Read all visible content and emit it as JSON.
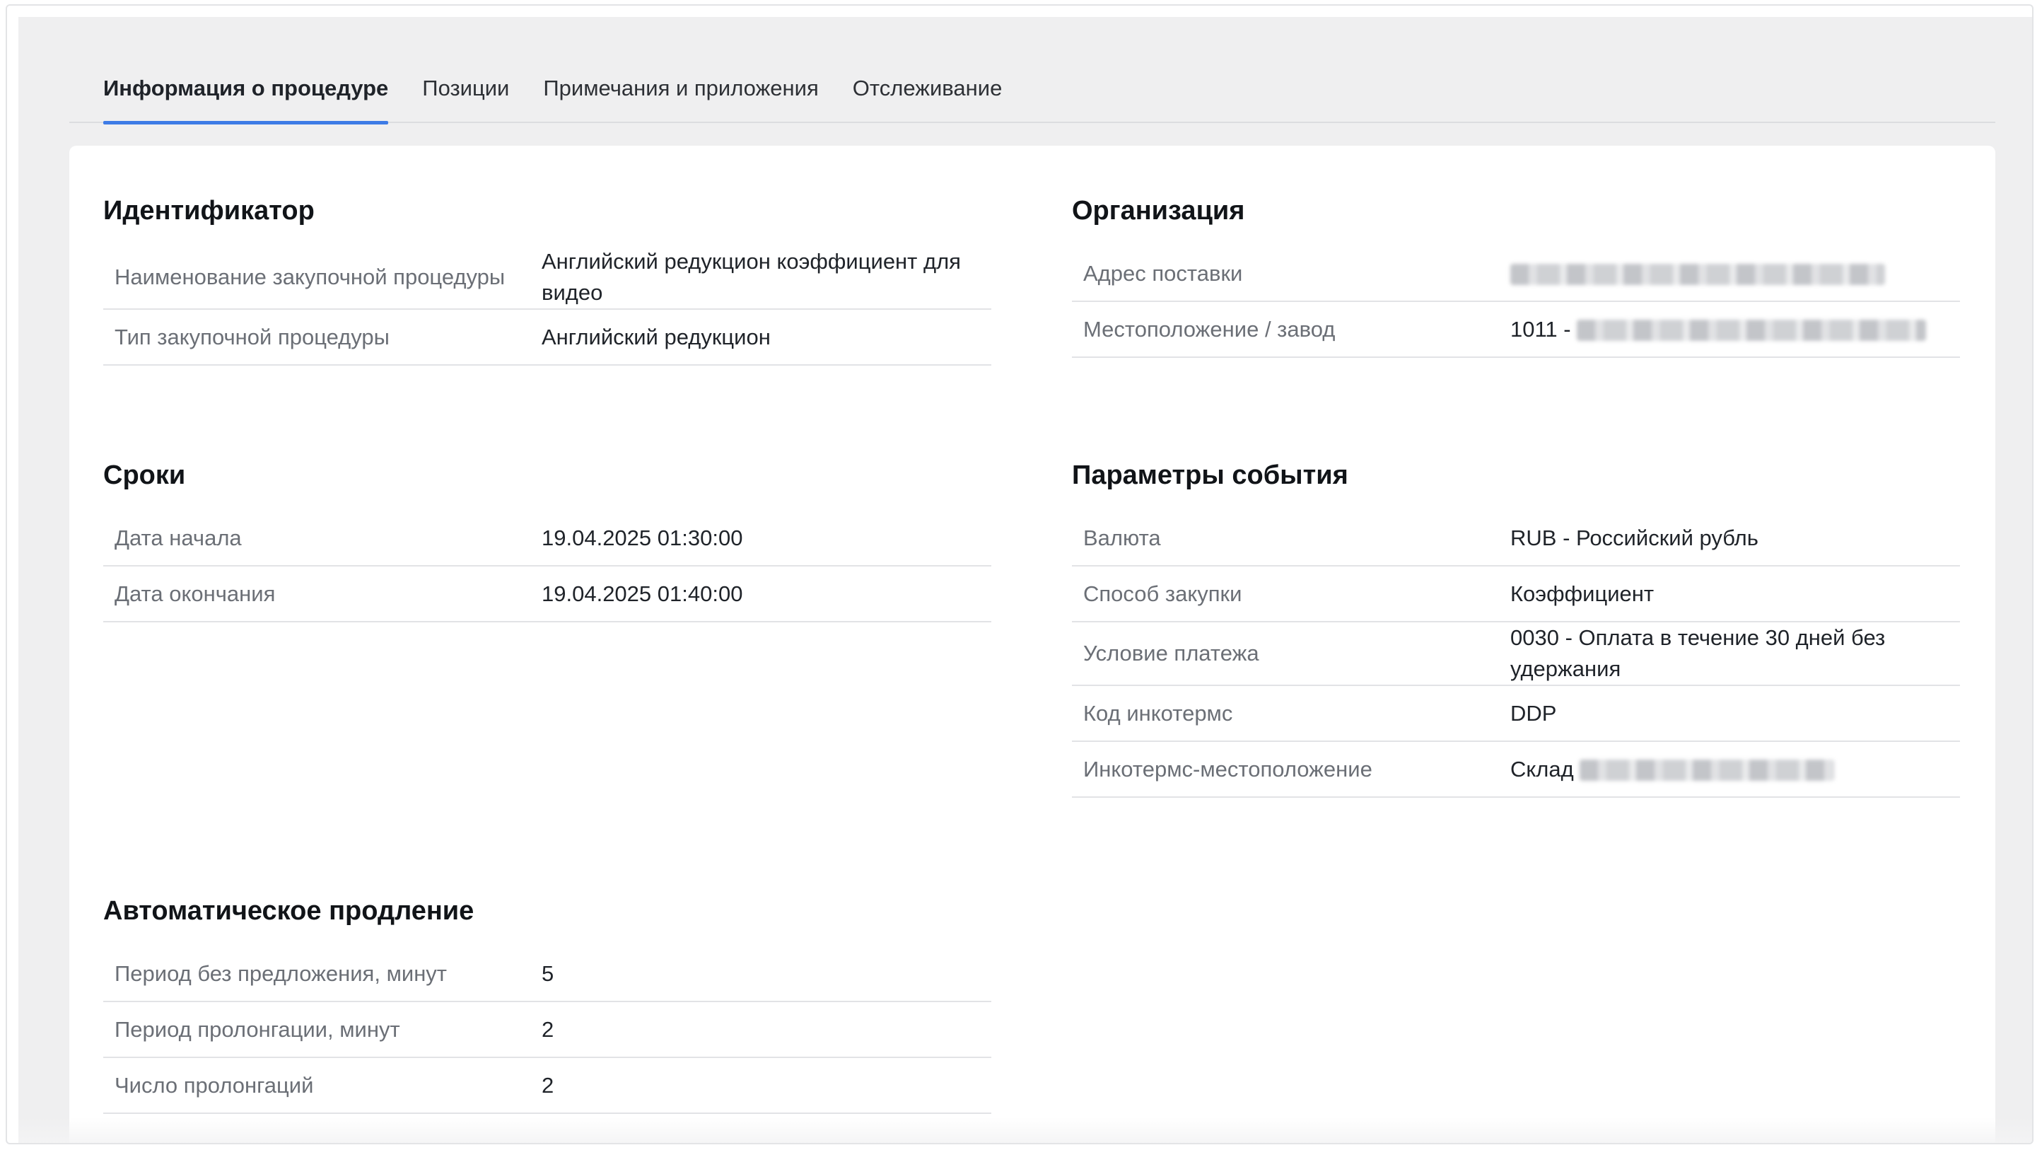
{
  "tabs": [
    {
      "label": "Информация о процедуре",
      "active": true
    },
    {
      "label": "Позиции",
      "active": false
    },
    {
      "label": "Примечания и приложения",
      "active": false
    },
    {
      "label": "Отслеживание",
      "active": false
    }
  ],
  "identifier": {
    "title": "Идентификатор",
    "rows": [
      {
        "label": "Наименование закупочной процедуры",
        "value": "Английский редукцион коэффициент для видео"
      },
      {
        "label": "Тип закупочной процедуры",
        "value": "Английский редукцион"
      }
    ]
  },
  "organization": {
    "title": "Организация",
    "rows": [
      {
        "label": "Адрес поставки",
        "value": ""
      },
      {
        "label": "Местоположение / завод",
        "value": "1011 -"
      }
    ]
  },
  "deadlines": {
    "title": "Сроки",
    "rows": [
      {
        "label": "Дата начала",
        "value": "19.04.2025 01:30:00"
      },
      {
        "label": "Дата окончания",
        "value": "19.04.2025 01:40:00"
      }
    ]
  },
  "event_params": {
    "title": "Параметры события",
    "rows": [
      {
        "label": "Валюта",
        "value": "RUB - Российский рубль"
      },
      {
        "label": "Способ закупки",
        "value": "Коэффициент"
      },
      {
        "label": "Условие платежа",
        "value": "0030 - Оплата в течение 30 дней без удержания"
      },
      {
        "label": "Код инкотермс",
        "value": "DDP"
      },
      {
        "label": "Инкотермс-местоположение",
        "value": "Склад"
      }
    ]
  },
  "auto_extension": {
    "title": "Автоматическое продление",
    "rows": [
      {
        "label": "Период без предложения, минут",
        "value": "5"
      },
      {
        "label": "Период пролонгации, минут",
        "value": "2"
      },
      {
        "label": "Число пролонгаций",
        "value": "2"
      }
    ]
  },
  "colors": {
    "accent": "#3d7be6",
    "panel_background": "#efeff0",
    "label_text": "#6b6f76",
    "divider": "#e2e3e6"
  }
}
